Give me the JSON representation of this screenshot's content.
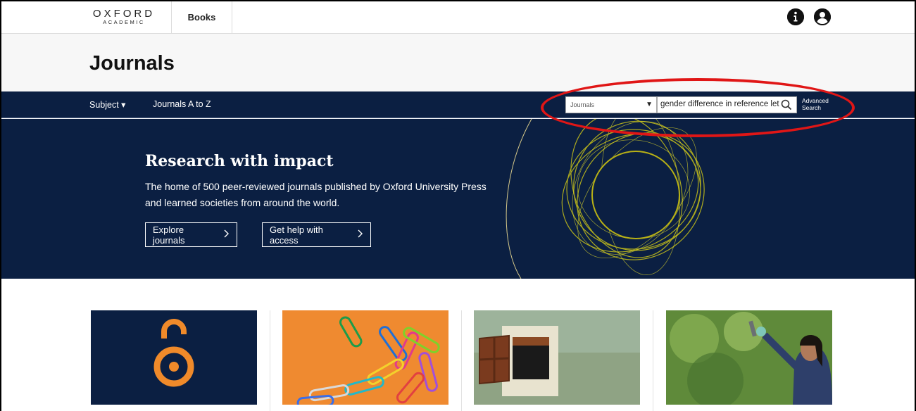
{
  "topbar": {
    "logo_line1": "OXFORD",
    "logo_line2": "ACADEMIC",
    "books_tab": "Books",
    "icons": [
      "info-icon",
      "account-icon"
    ]
  },
  "header": {
    "title": "Journals"
  },
  "nav": {
    "subject": "Subject ▾",
    "atoz": "Journals A to Z"
  },
  "search": {
    "scope_selected": "Journals",
    "query": "gender difference in reference let",
    "advanced_line1": "Advanced",
    "advanced_line2": "Search"
  },
  "hero": {
    "title": "Research with impact",
    "description": "The home of 500 peer-reviewed journals published by Oxford University Press and learned societies from around the world.",
    "explore_label": "Explore journals",
    "help_label": "Get help with access"
  },
  "colors": {
    "navy": "#0b1f42",
    "accent_red": "#e01616",
    "open_access_orange": "#f08a2a"
  },
  "cards": [
    {
      "image": "open-access-logo"
    },
    {
      "image": "paper-clips-photo"
    },
    {
      "image": "window-photo"
    },
    {
      "image": "scientist-photo"
    }
  ]
}
